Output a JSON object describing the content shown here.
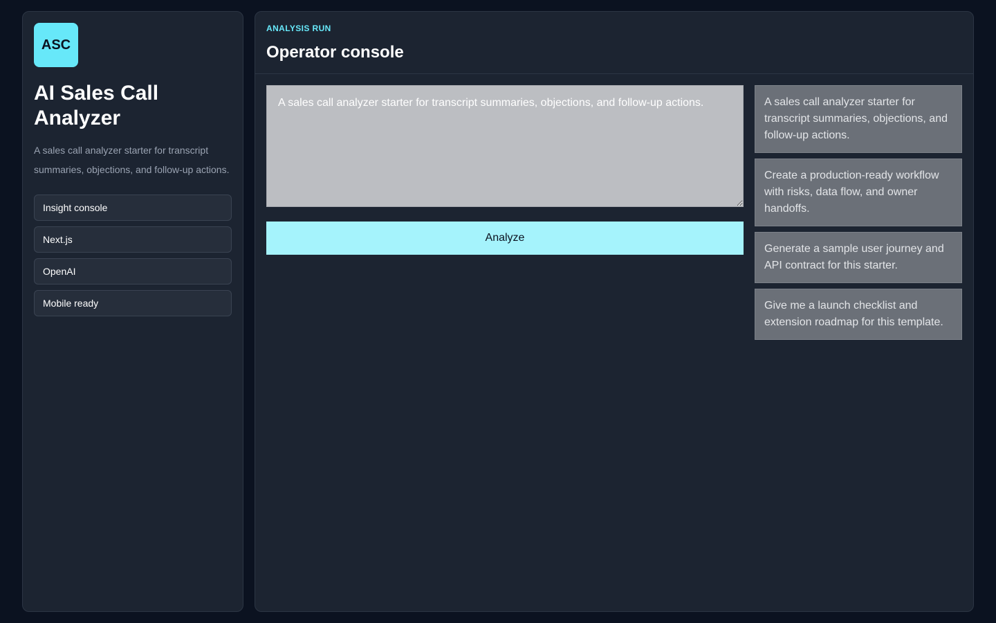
{
  "sidebar": {
    "logo_text": "ASC",
    "title": "AI Sales Call Analyzer",
    "description": "A sales call analyzer starter for transcript summaries, objections, and follow-up actions.",
    "tags": [
      {
        "label": "Insight console"
      },
      {
        "label": "Next.js"
      },
      {
        "label": "OpenAI"
      },
      {
        "label": "Mobile ready"
      }
    ]
  },
  "main": {
    "eyebrow": "ANALYSIS RUN",
    "title": "Operator console",
    "prompt_value": "A sales call analyzer starter for transcript summaries, objections, and follow-up actions.",
    "analyze_label": "Analyze",
    "suggestions": [
      {
        "text": "A sales call analyzer starter for transcript summaries, objections, and follow-up actions."
      },
      {
        "text": "Create a production-ready workflow with risks, data flow, and owner handoffs."
      },
      {
        "text": "Generate a sample user journey and API contract for this starter."
      },
      {
        "text": "Give me a launch checklist and extension roadmap for this template."
      }
    ]
  },
  "colors": {
    "background": "#0b1220",
    "panel": "#1c2431",
    "accent": "#67e8f9",
    "button": "#a5f3fc"
  }
}
